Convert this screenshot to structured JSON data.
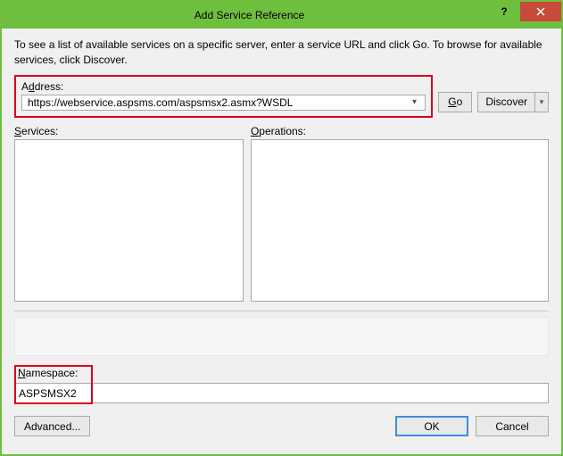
{
  "window": {
    "title": "Add Service Reference"
  },
  "instructions": "To see a list of available services on a specific server, enter a service URL and click Go. To browse for available services, click Discover.",
  "address": {
    "label_pre": "A",
    "label_u": "d",
    "label_post": "dress:",
    "value": "https://webservice.aspsms.com/aspsmsx2.asmx?WSDL"
  },
  "buttons": {
    "go_u": "G",
    "go_post": "o",
    "discover": "Discover",
    "advanced": "Advanced...",
    "ok": "OK",
    "cancel": "Cancel"
  },
  "lists": {
    "services_u": "S",
    "services_post": "ervices:",
    "operations_u": "O",
    "operations_post": "perations:"
  },
  "namespace": {
    "label_u": "N",
    "label_post": "amespace:",
    "value": "ASPSMSX2"
  }
}
